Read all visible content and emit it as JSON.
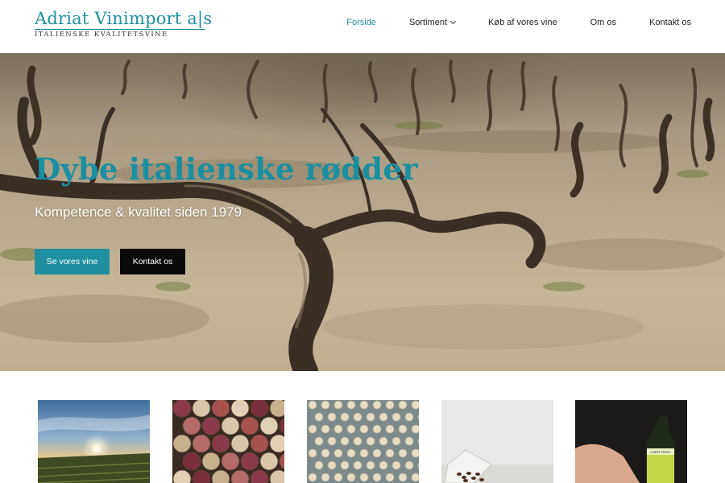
{
  "brand": {
    "name": "Adriat Vinimport a|s",
    "tagline": "ITALIENSKE KVALITETSVINE"
  },
  "nav": {
    "items": [
      {
        "label": "Forside",
        "active": true
      },
      {
        "label": "Sortiment",
        "has_dropdown": true
      },
      {
        "label": "Køb af vores vine"
      },
      {
        "label": "Om os"
      },
      {
        "label": "Kontakt os"
      }
    ]
  },
  "hero": {
    "title": "Dybe italienske rødder",
    "subtitle": "Kompetence & kvalitet siden 1979",
    "primary_button": "Se vores vine",
    "secondary_button": "Kontakt os",
    "image": "vineyard-old-vines"
  },
  "thumbnails": [
    {
      "image": "vineyard-sunset"
    },
    {
      "image": "wine-corks"
    },
    {
      "image": "bottle-caps-grid"
    },
    {
      "image": "coffee-beans-glass"
    },
    {
      "image": "olive-oil-bottle",
      "label_text": "LUIGI TEGA"
    }
  ],
  "colors": {
    "accent": "#1f8fa0",
    "dark_button": "#0b0b0b",
    "text": "#222222"
  }
}
